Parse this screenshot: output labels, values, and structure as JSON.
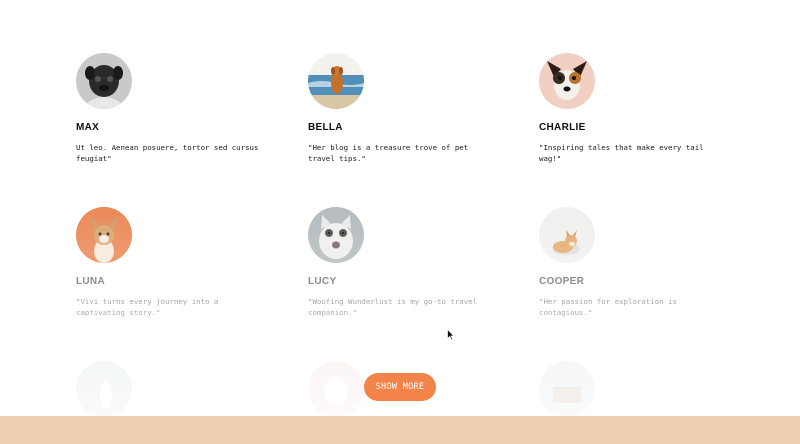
{
  "testimonials": [
    {
      "name": "MAX",
      "quote": "Ut leo. Aenean posuere, tortor sed cursus feugiat\""
    },
    {
      "name": "BELLA",
      "quote": "\"Her blog is a treasure trove of pet travel tips.\""
    },
    {
      "name": "CHARLIE",
      "quote": "\"Inspiring tales that make every tail wag!\""
    },
    {
      "name": "LUNA",
      "quote": "\"Vivi turns every journey into a captivating story.\""
    },
    {
      "name": "LUCY",
      "quote": "\"Woofing Wunderlust is my go-to travel companion.\""
    },
    {
      "name": "COOPER",
      "quote": "\"Her passion for exploration is contagious.\""
    }
  ],
  "show_more": {
    "label": "SHOW MORE"
  },
  "colors": {
    "accent": "#f2844a",
    "footer_band": "#f0cfb1",
    "text": "#111111"
  },
  "icons": {
    "cursor": "mouse-pointer-icon"
  }
}
